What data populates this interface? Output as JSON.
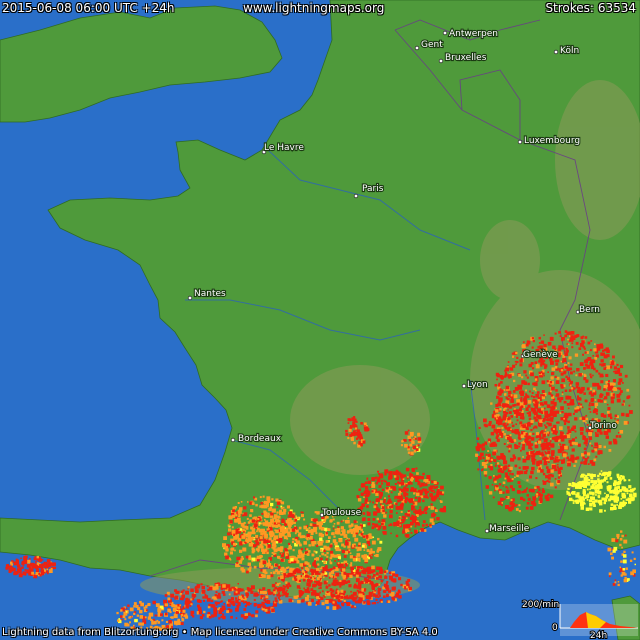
{
  "header": {
    "timestamp": "2015-06-08 06:00 UTC +24h",
    "site": "www.lightningmaps.org",
    "strokes_label": "Strokes:",
    "strokes_count": "63534"
  },
  "footer": {
    "credit": "Lightning data from Blitzortung.org",
    "separator": "•",
    "license": "Map licensed under Creative Commons BY-SA 4.0"
  },
  "legend": {
    "max_label": "200/min",
    "min_label": "0",
    "time_label": "24h"
  },
  "cities": [
    {
      "name": "Gent"
    },
    {
      "name": "Antwerpen"
    },
    {
      "name": "Bruxelles"
    },
    {
      "name": "Köln"
    },
    {
      "name": "Luxembourg"
    },
    {
      "name": "Le Havre"
    },
    {
      "name": "Paris"
    },
    {
      "name": "Nantes"
    },
    {
      "name": "Bern"
    },
    {
      "name": "Genève"
    },
    {
      "name": "Lyon"
    },
    {
      "name": "Torino"
    },
    {
      "name": "Bordeaux"
    },
    {
      "name": "Toulouse"
    },
    {
      "name": "Marseille"
    }
  ],
  "colors": {
    "sea": "#2a6fc9",
    "land": "#4f9a3b",
    "land_dark": "#3e7f2d",
    "mountain": "#8c9a5a",
    "strike_recent": "#ffff33",
    "strike_mid": "#ff9922",
    "strike_old": "#ee2211"
  }
}
